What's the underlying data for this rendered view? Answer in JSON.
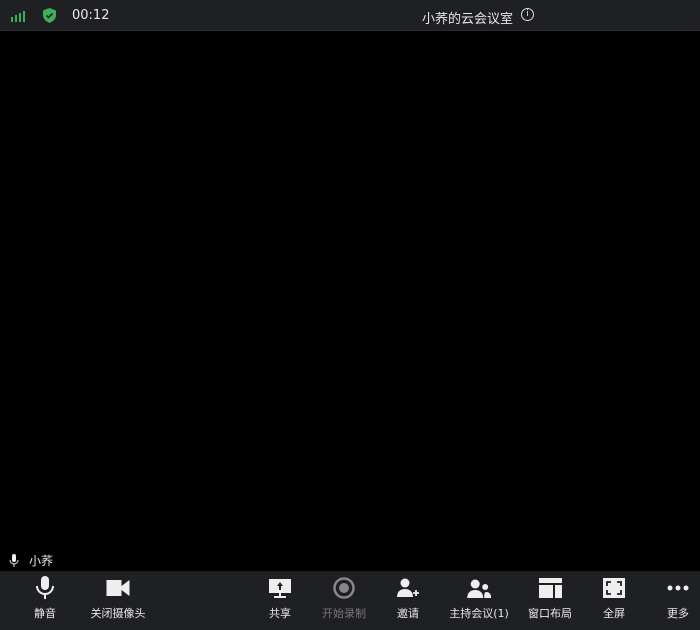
{
  "header": {
    "time": "00:12",
    "title": "小荞的云会议室",
    "info_icon": "ⓘ"
  },
  "participant": {
    "name": "小荞"
  },
  "toolbar": [
    {
      "id": "mute",
      "label": "静音",
      "icon": "microphone-icon"
    },
    {
      "id": "camera",
      "label": "关闭摄像头",
      "icon": "camera-icon"
    },
    {
      "id": "share",
      "label": "共享",
      "icon": "share-screen-icon"
    },
    {
      "id": "record",
      "label": "开始录制",
      "icon": "record-icon",
      "disabled": true
    },
    {
      "id": "invite",
      "label": "邀请",
      "icon": "add-user-icon"
    },
    {
      "id": "host",
      "label": "主持会议(1)",
      "icon": "participants-icon"
    },
    {
      "id": "layout",
      "label": "窗口布局",
      "icon": "layout-icon"
    },
    {
      "id": "fullscreen",
      "label": "全屏",
      "icon": "fullscreen-icon"
    },
    {
      "id": "more",
      "label": "更多",
      "icon": "more-icon"
    }
  ],
  "colors": {
    "signal": "#3fae5a",
    "bar": "#1f2023"
  }
}
